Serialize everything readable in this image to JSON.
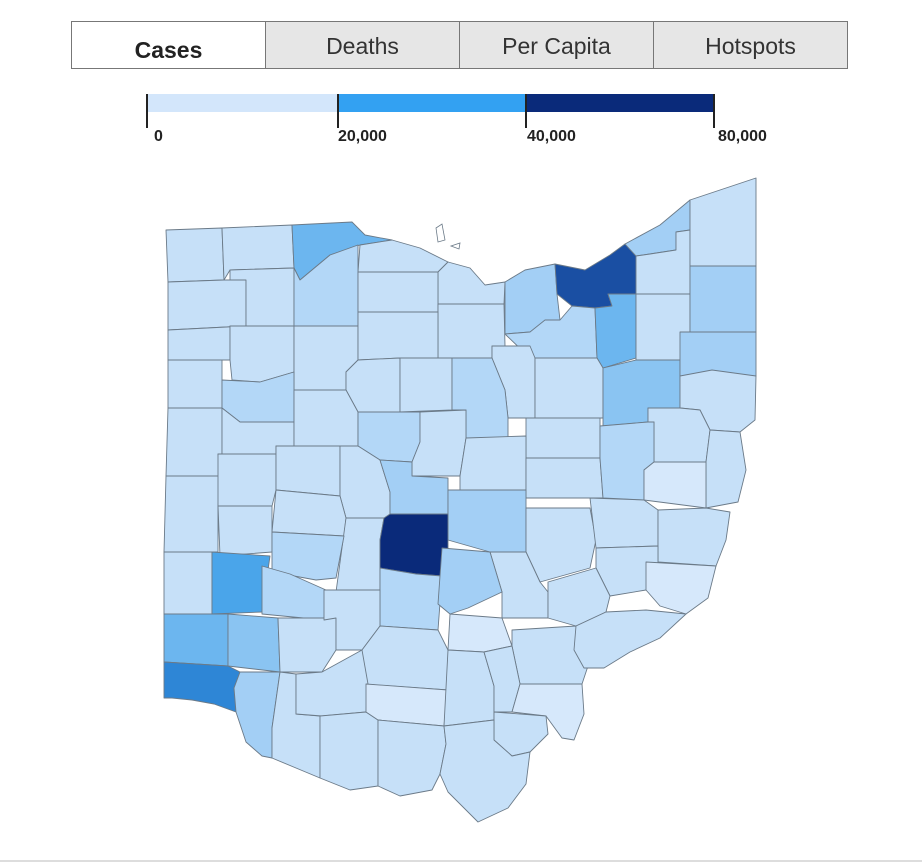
{
  "tabs": [
    {
      "label": "Cases",
      "active": true
    },
    {
      "label": "Deaths",
      "active": false
    },
    {
      "label": "Per Capita",
      "active": false
    },
    {
      "label": "Hotspots",
      "active": false
    }
  ],
  "legend": {
    "labels": [
      "0",
      "20,000",
      "40,000",
      "80,000"
    ],
    "colors": [
      "#d3e6fb",
      "#33a1f2",
      "#0a2a7a"
    ]
  },
  "colors": {
    "very_light": "#d6e8fb",
    "light": "#c6e0f8",
    "light_mid": "#b3d7f7",
    "mid_light": "#a3cff5",
    "mid": "#8ac4f2",
    "mid_strong": "#6cb6ef",
    "strong": "#4aa5ea",
    "deep": "#2e86d6",
    "darker": "#1a4fa3",
    "darkest": "#0a2a7a"
  }
}
